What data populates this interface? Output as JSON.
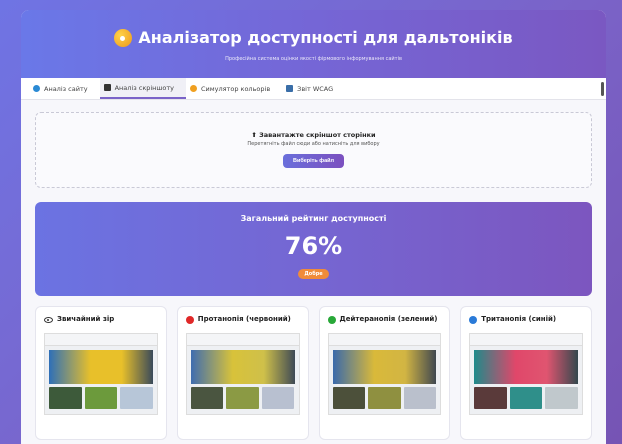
{
  "header": {
    "title": "Аналізатор доступності для дальтоніків",
    "subtitle": "Професійна система оцінки якості фірмового інформування сайтів"
  },
  "tabs": [
    {
      "label": "Аналіз сайту",
      "icon": "globe-icon",
      "color": "#2a8ad4"
    },
    {
      "label": "Аналіз скріншоту",
      "icon": "image-icon",
      "color": "#333333"
    },
    {
      "label": "Симулятор кольорів",
      "icon": "palette-icon",
      "color": "#f0a020"
    },
    {
      "label": "Звіт WCAG",
      "icon": "report-icon",
      "color": "#3a6ea8"
    }
  ],
  "upload": {
    "title": "Завантажте скріншот сторінки",
    "subtitle": "Перетягніть файл сюди або натисніть для вибору",
    "button": "Виберіть файл"
  },
  "score": {
    "title": "Загальний рейтинг доступності",
    "value": "76%",
    "badge": "Добре"
  },
  "simulations": [
    {
      "label": "Звичайний зір",
      "icon": "eye-icon",
      "color": "#333333",
      "hero": "#e8c02a"
    },
    {
      "label": "Протанопія (червоний)",
      "icon": "red-dot-icon",
      "color": "#e02828",
      "hero": "#d8c23a"
    },
    {
      "label": "Дейтеранопія (зелений)",
      "icon": "green-dot-icon",
      "color": "#28a838",
      "hero": "#d9b93a"
    },
    {
      "label": "Тританопія (синій)",
      "icon": "blue-dot-icon",
      "color": "#2a7ad8",
      "hero": "#e0476a"
    }
  ],
  "colors": {
    "accent": "#7566d2",
    "badge": "#f08b3a"
  }
}
